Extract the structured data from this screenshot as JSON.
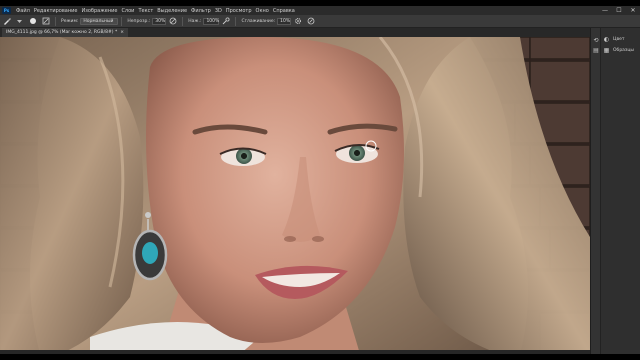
{
  "app": {
    "logo_text": "Ps"
  },
  "menu": [
    "Файл",
    "Редактирование",
    "Изображение",
    "Слои",
    "Текст",
    "Выделение",
    "Фильтр",
    "3D",
    "Просмотр",
    "Окно",
    "Справка"
  ],
  "window_controls": {
    "minimize": "—",
    "maximize": "☐",
    "close": "✕"
  },
  "options_bar": {
    "mode_label": "Режим:",
    "mode_value": "Нормальный",
    "opacity_label": "Непрозр.:",
    "opacity_value": "30%",
    "pressure_label": "Наж.:",
    "pressure_value": "100%",
    "smoothing_label": "Сглаживание:",
    "smoothing_value": "10%"
  },
  "document_tab": {
    "title": "IMG_4111.jpg @ 66,7% (Mar кожно 2, RGB/8#) *",
    "close": "×"
  },
  "panels": {
    "items": [
      {
        "label": "Цвет",
        "icon": "color-icon"
      },
      {
        "label": "Образцы",
        "icon": "swatches-icon"
      }
    ]
  },
  "colors": {
    "menubar": "#2b2b2b",
    "options": "#3a3a3a",
    "panel": "#2f2f2f",
    "accent": "#31a8ff"
  }
}
